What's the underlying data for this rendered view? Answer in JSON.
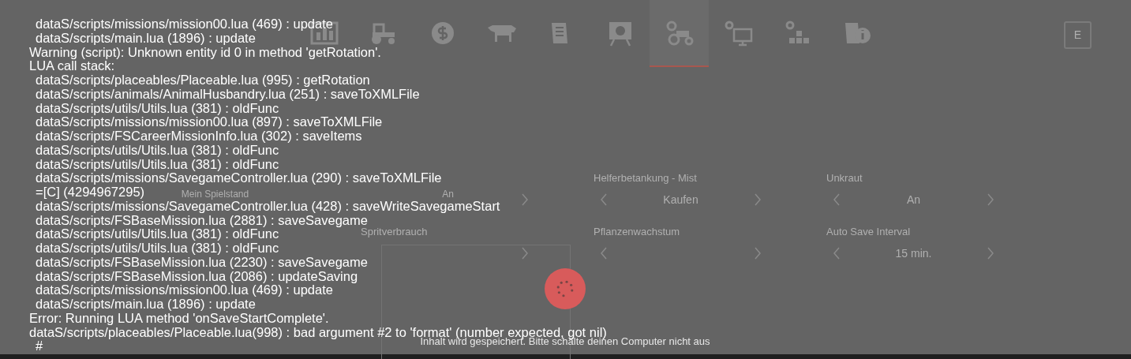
{
  "menu_tabs": [
    {
      "kind": "stats",
      "selected": false
    },
    {
      "kind": "vehicles",
      "selected": false
    },
    {
      "kind": "finances",
      "selected": false
    },
    {
      "kind": "animals",
      "selected": false
    },
    {
      "kind": "contracts",
      "selected": false
    },
    {
      "kind": "tour",
      "selected": false
    },
    {
      "kind": "game-settings",
      "selected": true
    },
    {
      "kind": "general-settings",
      "selected": false
    },
    {
      "kind": "controls",
      "selected": false
    },
    {
      "kind": "help",
      "selected": false
    }
  ],
  "key_hint": "E",
  "settings_columns": [
    {
      "items": [
        {
          "kind": "text",
          "value": "Mein Spielstand"
        }
      ]
    },
    {
      "items": [
        {
          "kind": "selector-right",
          "value": "An"
        },
        {
          "kind": "selector-right",
          "label": "Spritverbrauch"
        }
      ]
    },
    {
      "items": [
        {
          "kind": "selector",
          "label": "Helferbetankung - Mist",
          "value": "Kaufen"
        },
        {
          "kind": "selector",
          "label": "Pflanzenwachstum"
        }
      ]
    },
    {
      "items": [
        {
          "kind": "selector",
          "label": "Unkraut",
          "value": "An"
        },
        {
          "kind": "selector",
          "label": "Auto Save Interval",
          "value": "15 min."
        }
      ]
    }
  ],
  "console": {
    "lines": [
      {
        "kind": "frame",
        "text": "dataS/scripts/missions/mission00.lua (469) : update"
      },
      {
        "kind": "frame",
        "text": "dataS/scripts/main.lua (1896) : update"
      },
      {
        "kind": "message",
        "text": "Warning (script): Unknown entity id 0 in method 'getRotation'."
      },
      {
        "kind": "message",
        "text": "LUA call stack:"
      },
      {
        "kind": "frame",
        "text": "dataS/scripts/placeables/Placeable.lua (995) : getRotation"
      },
      {
        "kind": "frame",
        "text": "dataS/scripts/animals/AnimalHusbandry.lua (251) : saveToXMLFile"
      },
      {
        "kind": "frame",
        "text": "dataS/scripts/utils/Utils.lua (381) : oldFunc"
      },
      {
        "kind": "frame",
        "text": "dataS/scripts/missions/mission00.lua (897) : saveToXMLFile"
      },
      {
        "kind": "frame",
        "text": "dataS/scripts/FSCareerMissionInfo.lua (302) : saveItems"
      },
      {
        "kind": "frame",
        "text": "dataS/scripts/utils/Utils.lua (381) : oldFunc"
      },
      {
        "kind": "frame",
        "text": "dataS/scripts/utils/Utils.lua (381) : oldFunc"
      },
      {
        "kind": "frame",
        "text": "dataS/scripts/missions/SavegameController.lua (290) : saveToXMLFile"
      },
      {
        "kind": "frame",
        "text": "=[C] (4294967295)"
      },
      {
        "kind": "frame",
        "text": "dataS/scripts/missions/SavegameController.lua (428) : saveWriteSavegameStart"
      },
      {
        "kind": "frame",
        "text": "dataS/scripts/FSBaseMission.lua (2881) : saveSavegame"
      },
      {
        "kind": "frame",
        "text": "dataS/scripts/utils/Utils.lua (381) : oldFunc"
      },
      {
        "kind": "frame",
        "text": "dataS/scripts/utils/Utils.lua (381) : oldFunc"
      },
      {
        "kind": "frame",
        "text": "dataS/scripts/FSBaseMission.lua (2230) : saveSavegame"
      },
      {
        "kind": "frame",
        "text": "dataS/scripts/FSBaseMission.lua (2086) : updateSaving"
      },
      {
        "kind": "frame",
        "text": "dataS/scripts/missions/mission00.lua (469) : update"
      },
      {
        "kind": "frame",
        "text": "dataS/scripts/main.lua (1896) : update"
      },
      {
        "kind": "message",
        "text": "Error: Running LUA method 'onSaveStartComplete'."
      },
      {
        "kind": "message",
        "text": "dataS/scripts/placeables/Placeable.lua(998) : bad argument #2 to 'format' (number expected, got nil)"
      },
      {
        "kind": "frame",
        "text": "#"
      }
    ]
  },
  "saving": {
    "message": "Inhalt wird gespeichert. Bitte schalte deinen Computer nicht aus"
  }
}
